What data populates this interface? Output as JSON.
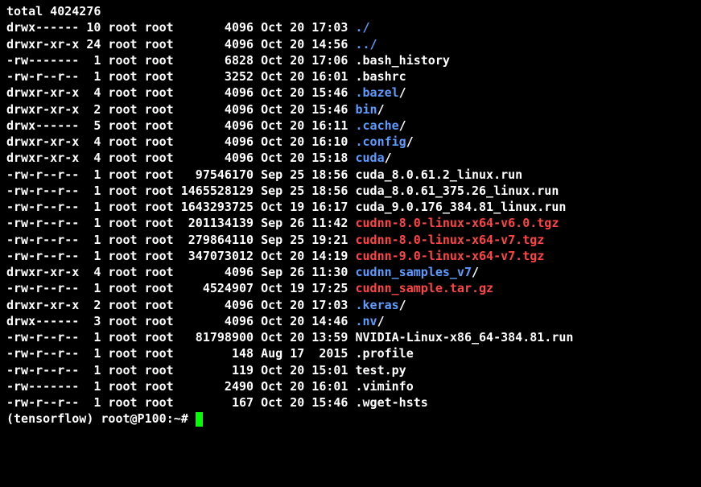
{
  "total_line": "total 4024276",
  "entries": [
    {
      "perms": "drwx------",
      "links": "10",
      "owner": "root",
      "group": "root",
      "size": "4096",
      "month": "Oct",
      "day": "20",
      "time": "17:03",
      "name": "./",
      "cls": "dir-blue"
    },
    {
      "perms": "drwxr-xr-x",
      "links": "24",
      "owner": "root",
      "group": "root",
      "size": "4096",
      "month": "Oct",
      "day": "20",
      "time": "14:56",
      "name": "../",
      "cls": "dir-blue"
    },
    {
      "perms": "-rw-------",
      "links": "1",
      "owner": "root",
      "group": "root",
      "size": "6828",
      "month": "Oct",
      "day": "20",
      "time": "17:06",
      "name": ".bash_history",
      "cls": "normal"
    },
    {
      "perms": "-rw-r--r--",
      "links": "1",
      "owner": "root",
      "group": "root",
      "size": "3252",
      "month": "Oct",
      "day": "20",
      "time": "16:01",
      "name": ".bashrc",
      "cls": "normal"
    },
    {
      "perms": "drwxr-xr-x",
      "links": "4",
      "owner": "root",
      "group": "root",
      "size": "4096",
      "month": "Oct",
      "day": "20",
      "time": "15:46",
      "name": ".bazel/",
      "cls": "dir-blue",
      "suffix_white": "/"
    },
    {
      "perms": "drwxr-xr-x",
      "links": "2",
      "owner": "root",
      "group": "root",
      "size": "4096",
      "month": "Oct",
      "day": "20",
      "time": "15:46",
      "name": "bin/",
      "cls": "dir-blue",
      "suffix_white": "/"
    },
    {
      "perms": "drwx------",
      "links": "5",
      "owner": "root",
      "group": "root",
      "size": "4096",
      "month": "Oct",
      "day": "20",
      "time": "16:11",
      "name": ".cache/",
      "cls": "dir-blue",
      "suffix_white": "/"
    },
    {
      "perms": "drwxr-xr-x",
      "links": "4",
      "owner": "root",
      "group": "root",
      "size": "4096",
      "month": "Oct",
      "day": "20",
      "time": "16:10",
      "name": ".config/",
      "cls": "dir-blue",
      "suffix_white": "/"
    },
    {
      "perms": "drwxr-xr-x",
      "links": "4",
      "owner": "root",
      "group": "root",
      "size": "4096",
      "month": "Oct",
      "day": "20",
      "time": "15:18",
      "name": "cuda/",
      "cls": "dir-blue",
      "suffix_white": "/"
    },
    {
      "perms": "-rw-r--r--",
      "links": "1",
      "owner": "root",
      "group": "root",
      "size": "97546170",
      "month": "Sep",
      "day": "25",
      "time": "18:56",
      "name": "cuda_8.0.61.2_linux.run",
      "cls": "normal"
    },
    {
      "perms": "-rw-r--r--",
      "links": "1",
      "owner": "root",
      "group": "root",
      "size": "1465528129",
      "month": "Sep",
      "day": "25",
      "time": "18:56",
      "name": "cuda_8.0.61_375.26_linux.run",
      "cls": "normal"
    },
    {
      "perms": "-rw-r--r--",
      "links": "1",
      "owner": "root",
      "group": "root",
      "size": "1643293725",
      "month": "Oct",
      "day": "19",
      "time": "16:17",
      "name": "cuda_9.0.176_384.81_linux.run",
      "cls": "normal"
    },
    {
      "perms": "-rw-r--r--",
      "links": "1",
      "owner": "root",
      "group": "root",
      "size": "201134139",
      "month": "Sep",
      "day": "26",
      "time": "11:42",
      "name": "cudnn-8.0-linux-x64-v6.0.tgz",
      "cls": "archive"
    },
    {
      "perms": "-rw-r--r--",
      "links": "1",
      "owner": "root",
      "group": "root",
      "size": "279864110",
      "month": "Sep",
      "day": "25",
      "time": "19:21",
      "name": "cudnn-8.0-linux-x64-v7.tgz",
      "cls": "archive"
    },
    {
      "perms": "-rw-r--r--",
      "links": "1",
      "owner": "root",
      "group": "root",
      "size": "347073012",
      "month": "Oct",
      "day": "20",
      "time": "14:19",
      "name": "cudnn-9.0-linux-x64-v7.tgz",
      "cls": "archive"
    },
    {
      "perms": "drwxr-xr-x",
      "links": "4",
      "owner": "root",
      "group": "root",
      "size": "4096",
      "month": "Sep",
      "day": "26",
      "time": "11:30",
      "name": "cudnn_samples_v7/",
      "cls": "dir-blue",
      "suffix_white": "/"
    },
    {
      "perms": "-rw-r--r--",
      "links": "1",
      "owner": "root",
      "group": "root",
      "size": "4524907",
      "month": "Oct",
      "day": "19",
      "time": "17:25",
      "name": "cudnn_sample.tar.gz",
      "cls": "archive"
    },
    {
      "perms": "drwxr-xr-x",
      "links": "2",
      "owner": "root",
      "group": "root",
      "size": "4096",
      "month": "Oct",
      "day": "20",
      "time": "17:03",
      "name": ".keras/",
      "cls": "dir-blue",
      "suffix_white": "/"
    },
    {
      "perms": "drwx------",
      "links": "3",
      "owner": "root",
      "group": "root",
      "size": "4096",
      "month": "Oct",
      "day": "20",
      "time": "14:46",
      "name": ".nv/",
      "cls": "dir-blue",
      "suffix_white": "/"
    },
    {
      "perms": "-rw-r--r--",
      "links": "1",
      "owner": "root",
      "group": "root",
      "size": "81798900",
      "month": "Oct",
      "day": "20",
      "time": "13:59",
      "name": "NVIDIA-Linux-x86_64-384.81.run",
      "cls": "normal"
    },
    {
      "perms": "-rw-r--r--",
      "links": "1",
      "owner": "root",
      "group": "root",
      "size": "148",
      "month": "Aug",
      "day": "17",
      "time": " 2015",
      "name": ".profile",
      "cls": "normal"
    },
    {
      "perms": "-rw-r--r--",
      "links": "1",
      "owner": "root",
      "group": "root",
      "size": "119",
      "month": "Oct",
      "day": "20",
      "time": "15:01",
      "name": "test.py",
      "cls": "normal"
    },
    {
      "perms": "-rw-------",
      "links": "1",
      "owner": "root",
      "group": "root",
      "size": "2490",
      "month": "Oct",
      "day": "20",
      "time": "16:01",
      "name": ".viminfo",
      "cls": "normal"
    },
    {
      "perms": "-rw-r--r--",
      "links": "1",
      "owner": "root",
      "group": "root",
      "size": "167",
      "month": "Oct",
      "day": "20",
      "time": "15:46",
      "name": ".wget-hsts",
      "cls": "normal"
    }
  ],
  "prompt": {
    "env": "(tensorflow) ",
    "userhost": "root@P100",
    "sep": ":",
    "path": "~",
    "suffix": "# "
  }
}
